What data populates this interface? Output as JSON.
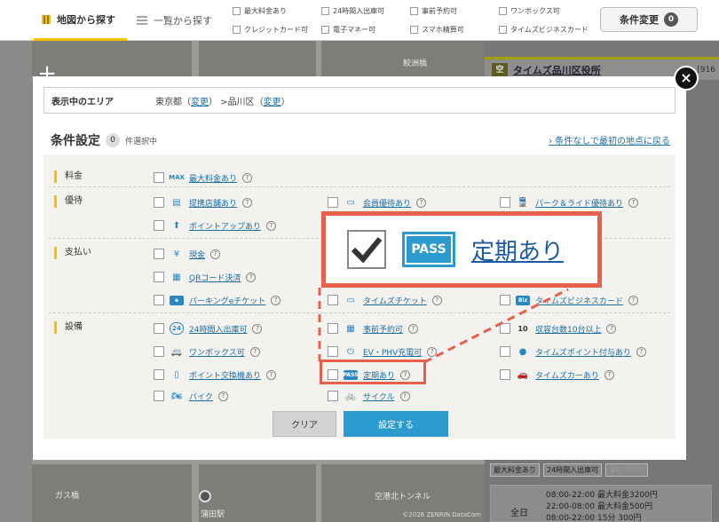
{
  "topbar": {
    "tab_map": "地図から探す",
    "tab_list": "一覧から探す",
    "chips": [
      "最大料金あり",
      "24時間入出庫可",
      "事前予約可",
      "ワンボックス可",
      "クレジットカード可",
      "電子マネー可",
      "スマホ精算可",
      "タイムズビジネスカード可"
    ],
    "condition_button": "条件変更",
    "condition_count": "0"
  },
  "map": {
    "labels": [
      "鮫洲橋",
      "ガス橋",
      "蒲田駅",
      "空港北トンネル"
    ],
    "copyright": "©2026 ZENRIN DataCom"
  },
  "side": {
    "marker": "空",
    "lot_name": "タイムズ品川区役所",
    "lot_id": "[916",
    "tags": [
      {
        "label": "最大料金あり",
        "on": true
      },
      {
        "label": "24時間入出庫可",
        "on": true
      },
      {
        "label": "事前予約可",
        "on": false
      }
    ],
    "hours_all": "全日",
    "hours": [
      "08:00-22:00 最大料金3200円",
      "22:00-08:00 最大料金500円",
      "08:00-22:00 15分 300円"
    ]
  },
  "modal": {
    "close_icon": "×",
    "area": {
      "label": "表示中のエリア",
      "pref": "東京都",
      "change": "変更",
      "ward": "品川区"
    },
    "title": "条件設定",
    "selected_count": "0",
    "selected_suffix": "件選択中",
    "reset_link": "条件なしで最初の地点に戻る",
    "sections": {
      "fee": "料金",
      "benefit": "優待",
      "payment": "支払い",
      "facility": "設備"
    },
    "options": {
      "max_fee": "最大料金あり",
      "partner_store": "提携店舗あり",
      "member_benefit": "会員優待あり",
      "park_ride": "パーク＆ライド優待あり",
      "point_up": "ポイントアップあり",
      "cash": "現金",
      "qr": "QRコード決済",
      "parking_ticket": "パーキングeチケット",
      "times_ticket": "タイムズチケット",
      "times_business_card": "タイムズビジネスカード",
      "h24": "24時間入出庫可",
      "reservation": "事前予約可",
      "capacity10": "収容台数10台以上",
      "onebox": "ワンボックス可",
      "ev": "EV・PHV充電可",
      "times_points": "タイムズポイント付与あり",
      "point_exchange": "ポイント交換機あり",
      "pass": "定期あり",
      "times_car": "タイムズカーあり",
      "bike": "バイク",
      "cycle": "サイクル"
    },
    "icon_texts": {
      "max": "MAX",
      "yen": "¥",
      "h24": "24",
      "ten": "10",
      "pass": "PASS"
    },
    "buttons": {
      "clear": "クリア",
      "set": "設定する"
    }
  },
  "callout": {
    "pass_badge": "PASS",
    "label": "定期あり"
  }
}
